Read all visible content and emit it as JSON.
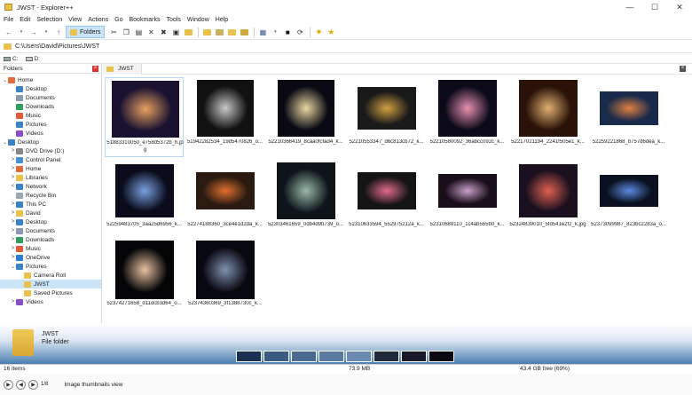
{
  "window": {
    "title": "JWST - Explorer++",
    "minimize": "—",
    "maximize": "☐",
    "close": "✕"
  },
  "menu": [
    "File",
    "Edit",
    "Selection",
    "View",
    "Actions",
    "Go",
    "Bookmarks",
    "Tools",
    "Window",
    "Help"
  ],
  "toolbar": {
    "folders_label": "Folders"
  },
  "address": {
    "path": "C:\\Users\\David\\Pictures\\JWST"
  },
  "drives": [
    "C:",
    "D:"
  ],
  "folders_pane": {
    "title": "Folders",
    "close": "×",
    "tree": [
      {
        "label": "Home",
        "expander": "⌄",
        "indent": 0,
        "color": "#e06c3a"
      },
      {
        "label": "Desktop",
        "expander": "",
        "indent": 1,
        "color": "#3b82c4"
      },
      {
        "label": "Documents",
        "expander": "",
        "indent": 1,
        "color": "#8a9bb0"
      },
      {
        "label": "Downloads",
        "expander": "",
        "indent": 1,
        "color": "#2e9f5e"
      },
      {
        "label": "Music",
        "expander": "",
        "indent": 1,
        "color": "#e05a3a"
      },
      {
        "label": "Pictures",
        "expander": "",
        "indent": 1,
        "color": "#3b82c4"
      },
      {
        "label": "Videos",
        "expander": "",
        "indent": 1,
        "color": "#8a4fc4"
      },
      {
        "label": "Desktop",
        "expander": "⌄",
        "indent": 0,
        "color": "#3b82c4"
      },
      {
        "label": "DVD Drive (D:)",
        "expander": ">",
        "indent": 1,
        "color": "#888888"
      },
      {
        "label": "Control Panel",
        "expander": ">",
        "indent": 1,
        "color": "#4a90d0"
      },
      {
        "label": "Home",
        "expander": ">",
        "indent": 1,
        "color": "#e06c3a"
      },
      {
        "label": "Libraries",
        "expander": ">",
        "indent": 1,
        "color": "#e8c24a"
      },
      {
        "label": "Network",
        "expander": "<",
        "indent": 1,
        "color": "#3b82c4"
      },
      {
        "label": "Recycle Bin",
        "expander": "",
        "indent": 1,
        "color": "#9aa8b5"
      },
      {
        "label": "This PC",
        "expander": ">",
        "indent": 1,
        "color": "#3b82c4"
      },
      {
        "label": "David",
        "expander": ">",
        "indent": 1,
        "color": "#e8c24a"
      },
      {
        "label": "Desktop",
        "expander": ">",
        "indent": 1,
        "color": "#3b82c4"
      },
      {
        "label": "Documents",
        "expander": ">",
        "indent": 1,
        "color": "#8a9bb0"
      },
      {
        "label": "Downloads",
        "expander": ">",
        "indent": 1,
        "color": "#2e9f5e"
      },
      {
        "label": "Music",
        "expander": ">",
        "indent": 1,
        "color": "#e05a3a"
      },
      {
        "label": "OneDrive",
        "expander": ">",
        "indent": 1,
        "color": "#2b7cd3"
      },
      {
        "label": "Pictures",
        "expander": "⌄",
        "indent": 1,
        "color": "#3b82c4"
      },
      {
        "label": "Camera Roll",
        "expander": "",
        "indent": 2,
        "color": "#e8c24a"
      },
      {
        "label": "JWST",
        "expander": "",
        "indent": 2,
        "color": "#e8c24a",
        "selected": true
      },
      {
        "label": "Saved Pictures",
        "expander": "",
        "indent": 2,
        "color": "#e8c24a"
      },
      {
        "label": "Videos",
        "expander": ">",
        "indent": 1,
        "color": "#8a4fc4"
      }
    ]
  },
  "tab": {
    "label": "JWST",
    "close": "×"
  },
  "files": [
    {
      "name": "51883310050_e758d5372b_h.jpg",
      "bg": "#1a1230",
      "accent": "#e8a060",
      "w": 76,
      "h": 64
    },
    {
      "name": "51942282534_19d5470826_o...",
      "bg": "#111111",
      "accent": "#c8c8c8",
      "w": 64,
      "h": 64
    },
    {
      "name": "52210366419_8caa0fcfad4_k...",
      "bg": "#0a0a14",
      "accent": "#e8d8a0",
      "w": 64,
      "h": 64
    },
    {
      "name": "52210553347_d6c813cb72_k...",
      "bg": "#1a1a1a",
      "accent": "#d0a040",
      "w": 66,
      "h": 48
    },
    {
      "name": "52210580092_36abcc092c_k...",
      "bg": "#0c0a18",
      "accent": "#e890b0",
      "w": 66,
      "h": 64
    },
    {
      "name": "52217021194_2241f505e1_k...",
      "bg": "#2a1208",
      "accent": "#e0b070",
      "w": 66,
      "h": 64
    },
    {
      "name": "52259221868_b757d6dea_k...",
      "bg": "#1a2a4a",
      "accent": "#e08040",
      "w": 66,
      "h": 38
    },
    {
      "name": "52259483705_3aa25d6956_k...",
      "bg": "#0a0c1c",
      "accent": "#7aa0e0",
      "w": 66,
      "h": 60
    },
    {
      "name": "52274188360_3ce4e1d2da_k...",
      "bg": "#2a1a10",
      "accent": "#e07030",
      "w": 66,
      "h": 42
    },
    {
      "name": "52303461659_0db4d9b739_o...",
      "bg": "#0e141a",
      "accent": "#9ab8a8",
      "w": 66,
      "h": 64
    },
    {
      "name": "52310633594_552975212a_k...",
      "bg": "#141414",
      "accent": "#e06a8a",
      "w": 66,
      "h": 42
    },
    {
      "name": "52310689110_1c4ab555b0_k...",
      "bg": "#1a0e1a",
      "accent": "#c8a0c8",
      "w": 66,
      "h": 38
    },
    {
      "name": "52324839010_5fd541e2f2_k.jpg",
      "bg": "#1a1020",
      "accent": "#e06050",
      "w": 66,
      "h": 60
    },
    {
      "name": "52373099987_823bc2283a_o...",
      "bg": "#0a1020",
      "accent": "#5a8ae0",
      "w": 66,
      "h": 36
    },
    {
      "name": "52374271658_d11dcb3d64_o...",
      "bg": "#050508",
      "accent": "#e8c0a0",
      "w": 66,
      "h": 66
    },
    {
      "name": "52374360369_3f1388730c_k...",
      "bg": "#080810",
      "accent": "#8090b0",
      "w": 66,
      "h": 66
    }
  ],
  "display_window": {
    "name": "JWST",
    "type": "File folder",
    "strip": [
      "#1a3050",
      "#3a5a80",
      "#4a6a90",
      "#5a7aa0",
      "#6a8ab0",
      "#202a3a",
      "#1a1a2a",
      "#0a0a14"
    ]
  },
  "status": {
    "items": "16 items",
    "size": "73.9 MB",
    "free": "43.4 GB free (69%)"
  },
  "bottom": {
    "page": "1/8",
    "hint": "Image thumbnails view"
  }
}
